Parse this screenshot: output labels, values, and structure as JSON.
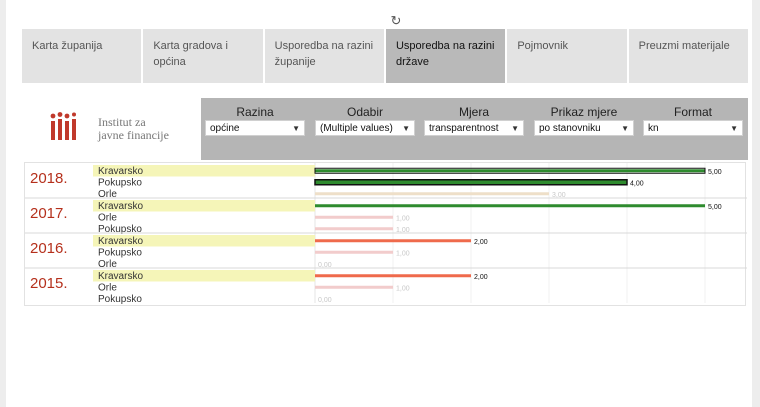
{
  "tabs": [
    {
      "label": "Karta županija",
      "active": false
    },
    {
      "label": "Karta gradova i općina",
      "active": false
    },
    {
      "label": "Usporedba na razini županije",
      "active": false
    },
    {
      "label": "Usporedba na razini države",
      "active": true
    },
    {
      "label": "Pojmovnik",
      "active": false
    },
    {
      "label": "Preuzmi materijale",
      "active": false
    }
  ],
  "logo": {
    "line1": "Institut za",
    "line2": "javne financije",
    "color": "#c0392b"
  },
  "filters": [
    {
      "label": "Razina",
      "value": "općine"
    },
    {
      "label": "Odabir",
      "value": "(Multiple values)"
    },
    {
      "label": "Mjera",
      "value": "transparentnost"
    },
    {
      "label": "Prikaz mjere",
      "value": "po stanovniku"
    },
    {
      "label": "Format",
      "value": "kn"
    }
  ],
  "colors": {
    "highlight": "#f5f5b8",
    "year": "#b5301c",
    "green": "#2e8b2e",
    "black": "#111111",
    "faint_tan": "#eedfc8",
    "faint_pink": "#f2cccc",
    "orange": "#ef6a4c"
  },
  "chart_data": {
    "type": "bar",
    "xlim": [
      0,
      5
    ],
    "groups": [
      {
        "year": "2018.",
        "rows": [
          {
            "name": "Kravarsko",
            "value": 5.0,
            "label": "5,00",
            "style": "green",
            "highlight": true
          },
          {
            "name": "Pokupsko",
            "value": 4.0,
            "label": "4,00",
            "style": "black",
            "highlight": false
          },
          {
            "name": "Orle",
            "value": 3.0,
            "label": "3,00",
            "style": "faint_tan",
            "highlight": false
          }
        ]
      },
      {
        "year": "2017.",
        "rows": [
          {
            "name": "Kravarsko",
            "value": 5.0,
            "label": "5,00",
            "style": "green",
            "highlight": true
          },
          {
            "name": "Orle",
            "value": 1.0,
            "label": "1,00",
            "style": "faint_pink",
            "highlight": false
          },
          {
            "name": "Pokupsko",
            "value": 1.0,
            "label": "1,00",
            "style": "faint_pink",
            "highlight": false
          }
        ]
      },
      {
        "year": "2016.",
        "rows": [
          {
            "name": "Kravarsko",
            "value": 2.0,
            "label": "2,00",
            "style": "orange",
            "highlight": true
          },
          {
            "name": "Pokupsko",
            "value": 1.0,
            "label": "1,00",
            "style": "faint_pink",
            "highlight": false
          },
          {
            "name": "Orle",
            "value": 0.0,
            "label": "0,00",
            "style": "faint_pink",
            "highlight": false
          }
        ]
      },
      {
        "year": "2015.",
        "rows": [
          {
            "name": "Kravarsko",
            "value": 2.0,
            "label": "2,00",
            "style": "orange",
            "highlight": true
          },
          {
            "name": "Orle",
            "value": 1.0,
            "label": "1,00",
            "style": "faint_pink",
            "highlight": false
          },
          {
            "name": "Pokupsko",
            "value": 0.0,
            "label": "0,00",
            "style": "faint_pink",
            "highlight": false
          }
        ]
      }
    ]
  }
}
